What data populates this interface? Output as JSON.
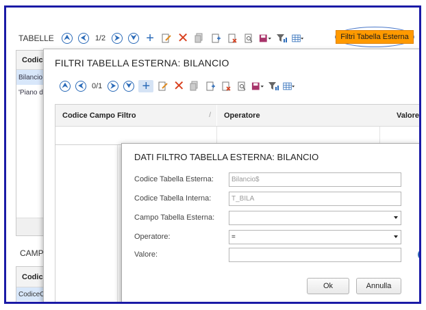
{
  "background": {
    "section_title": "TABELLE",
    "pager": "1/2",
    "external_filter_button": "Filtri Tabella Esterna",
    "grid_header": "Codic",
    "grid_rows": [
      "Bilancio",
      "'Piano d"
    ],
    "camp_label": "CAMP",
    "grid2_header": "Codic",
    "grid2_row": "CodiceC"
  },
  "filters_dialog": {
    "title": "FILTRI TABELLA ESTERNA: BILANCIO",
    "pager": "0/1",
    "columns": {
      "field": "Codice Campo Filtro",
      "operator": "Operatore",
      "value": "Valore"
    },
    "sort_mark": "/"
  },
  "detail_dialog": {
    "title": "DATI FILTRO TABELLA ESTERNA: BILANCIO",
    "fields": {
      "external_table_label": "Codice Tabella Esterna:",
      "external_table_value": "Bilancio$",
      "internal_table_label": "Codice Tabella Interna:",
      "internal_table_value": "T_BILA",
      "external_field_label": "Campo Tabella Esterna:",
      "external_field_value": "",
      "operator_label": "Operatore:",
      "operator_value": "=",
      "value_label": "Valore:",
      "value_value": ""
    },
    "help": "?",
    "ok": "Ok",
    "cancel": "Annulla"
  },
  "colors": {
    "frame": "#1a1aa6",
    "accent": "#2a6ab8",
    "highlight": "#ff9a00",
    "delete": "#d9401e"
  }
}
